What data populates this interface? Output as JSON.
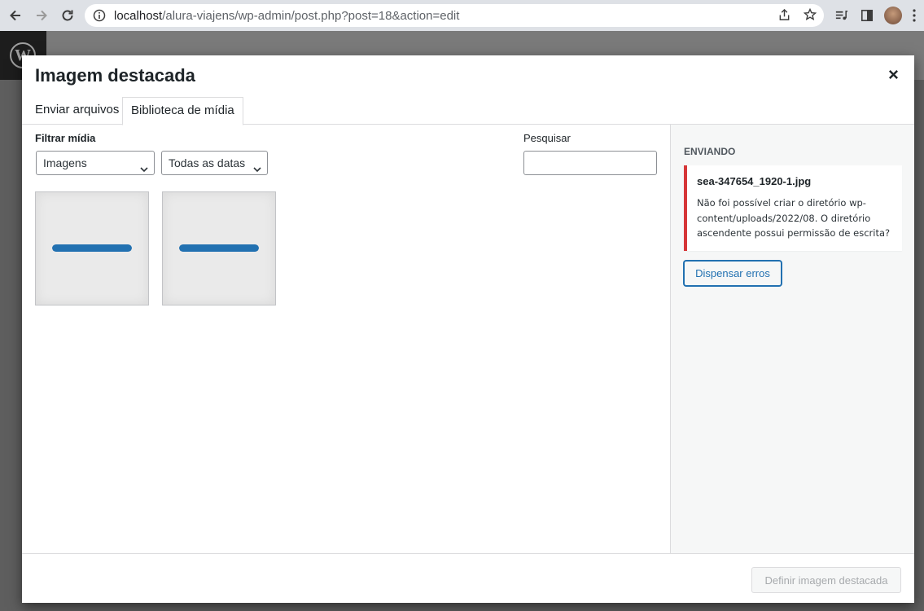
{
  "browser": {
    "url_host": "localhost",
    "url_path": "/alura-viajens/wp-admin/post.php?post=18&action=edit"
  },
  "modal": {
    "title": "Imagem destacada",
    "close_icon": "close-icon",
    "tabs": [
      {
        "label": "Enviar arquivos",
        "active": false
      },
      {
        "label": "Biblioteca de mídia",
        "active": true
      }
    ]
  },
  "filters": {
    "label": "Filtrar mídia",
    "type_selected": "Imagens",
    "date_selected": "Todas as datas",
    "search_label": "Pesquisar",
    "search_value": ""
  },
  "attachments": [
    {
      "progress": 1.0
    },
    {
      "progress": 1.0
    }
  ],
  "sidebar": {
    "heading": "ENVIANDO",
    "error_file": "sea-347654_1920-1.jpg",
    "error_message": "Não foi possível criar o diretório wp-content/uploads/2022/08. O diretório ascendente possui permissão de escrita?",
    "dismiss_label": "Dispensar erros"
  },
  "toolbar": {
    "set_label": "Definir imagem destacada"
  },
  "colors": {
    "accent": "#2271b1",
    "error": "#d63638"
  }
}
